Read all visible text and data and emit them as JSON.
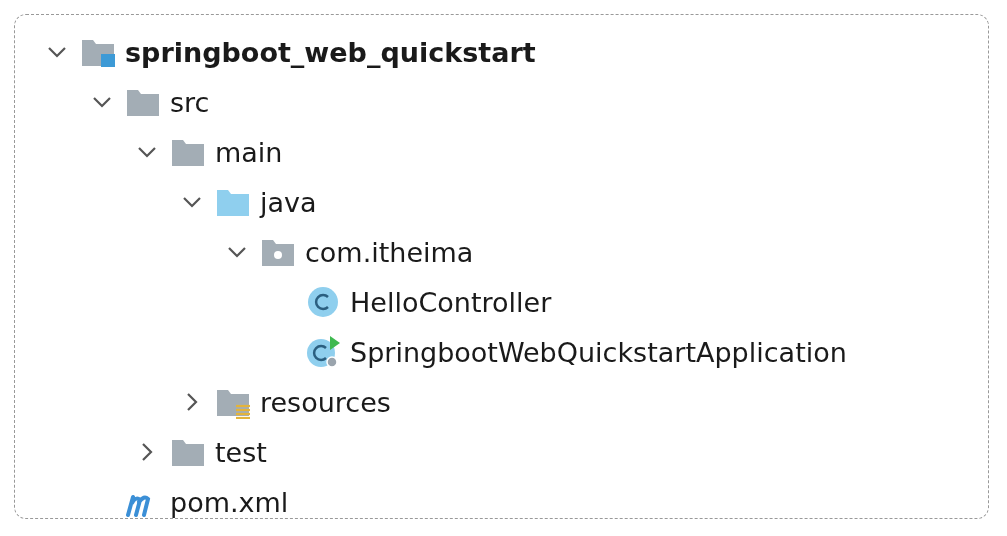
{
  "project_tree": [
    {
      "label": "springboot_web_quickstart",
      "kind": "module",
      "expanded": true,
      "children": [
        {
          "label": "src",
          "kind": "folder",
          "expanded": true,
          "children": [
            {
              "label": "main",
              "kind": "folder",
              "expanded": true,
              "children": [
                {
                  "label": "java",
                  "kind": "source-folder",
                  "expanded": true,
                  "children": [
                    {
                      "label": "com.itheima",
                      "kind": "package",
                      "expanded": true,
                      "children": [
                        {
                          "label": "HelloController",
                          "kind": "class"
                        },
                        {
                          "label": "SpringbootWebQuickstartApplication",
                          "kind": "app-class"
                        }
                      ]
                    }
                  ]
                },
                {
                  "label": "resources",
                  "kind": "resources-folder",
                  "expanded": false
                }
              ]
            },
            {
              "label": "test",
              "kind": "folder",
              "expanded": false
            }
          ]
        },
        {
          "label": "pom.xml",
          "kind": "maven"
        }
      ]
    }
  ]
}
